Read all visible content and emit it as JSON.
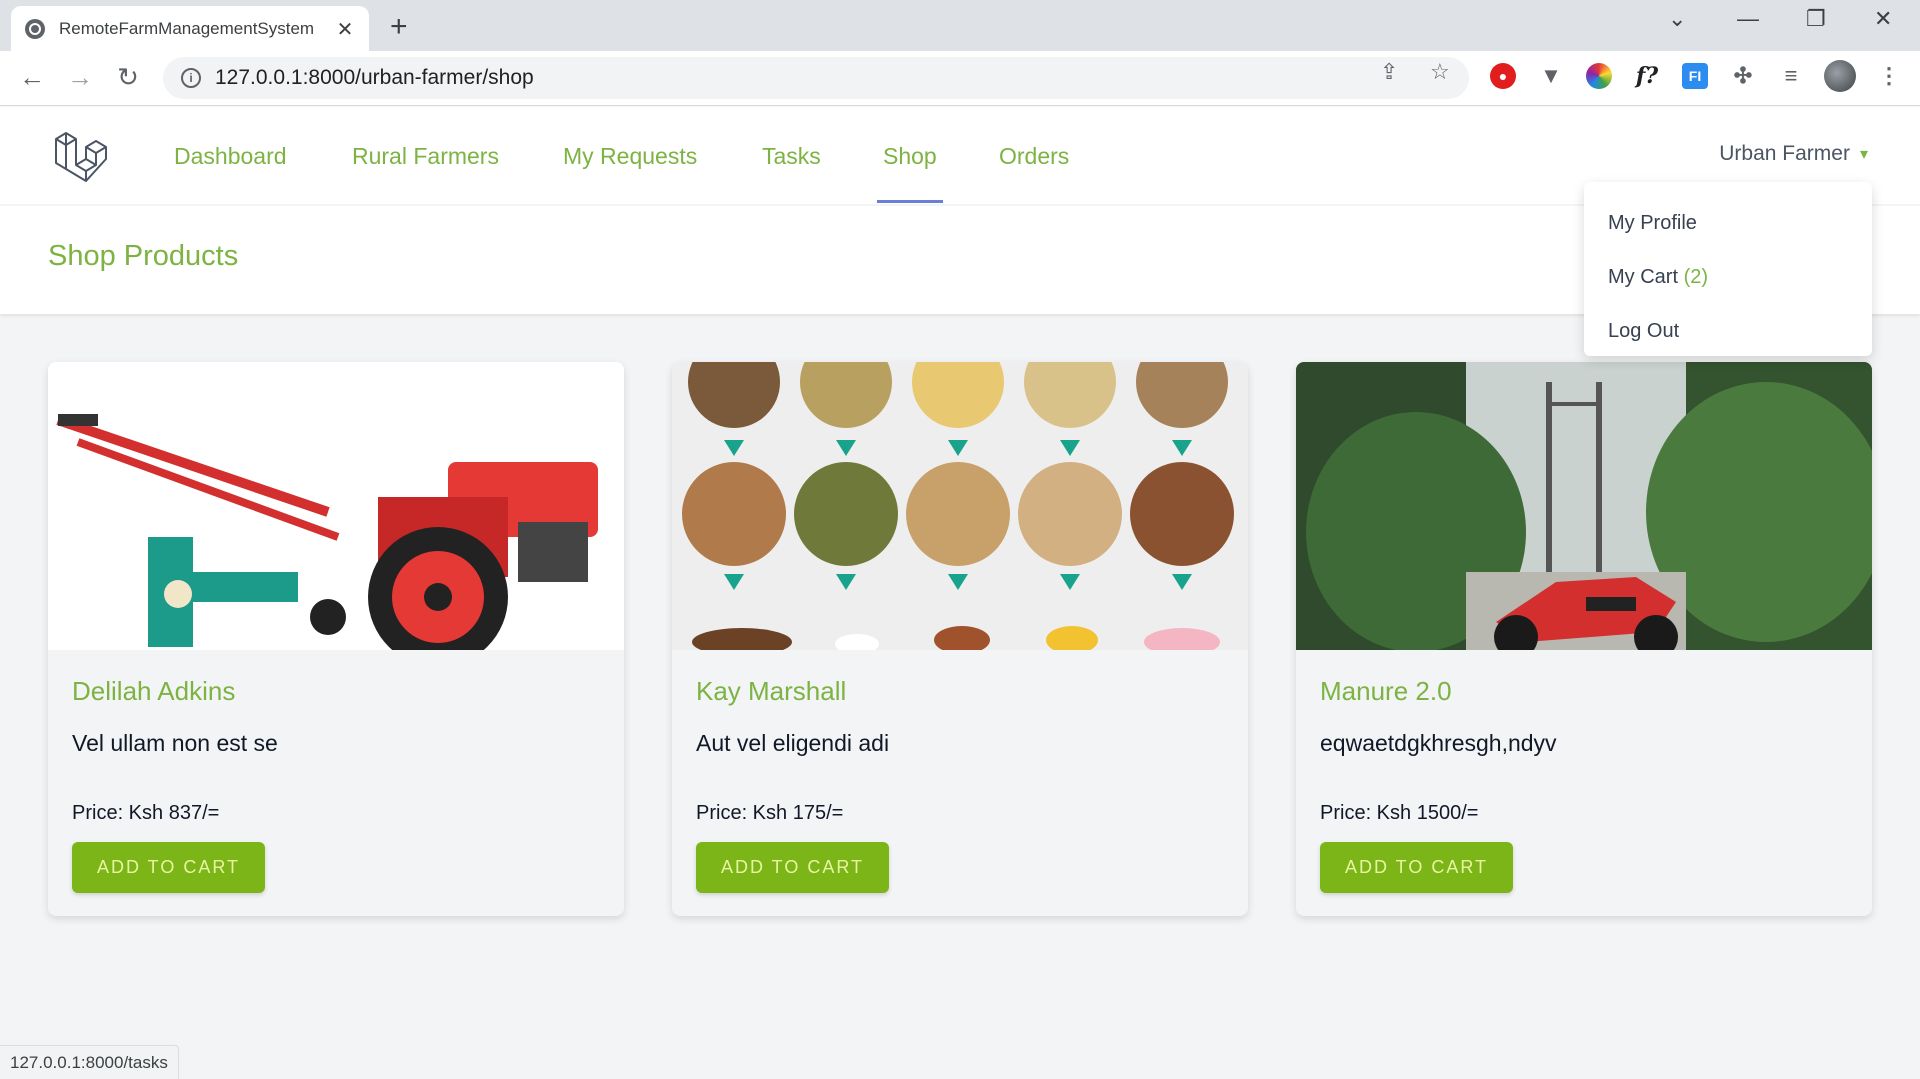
{
  "browser": {
    "tab_title": "RemoteFarmManagementSystem",
    "tab_close": "✕",
    "new_tab": "+",
    "url": "127.0.0.1:8000/urban-farmer/shop",
    "status_url": "127.0.0.1:8000/tasks",
    "extensions": [
      "adblock-icon",
      "vivaldi-icon",
      "color-picker-icon",
      "formula-icon",
      "fi-icon",
      "puzzle-icon",
      "media-icon",
      "avatar"
    ]
  },
  "nav": {
    "links": [
      "Dashboard",
      "Rural Farmers",
      "My Requests",
      "Tasks",
      "Shop",
      "Orders"
    ],
    "active": "Shop",
    "user": "Urban Farmer"
  },
  "dropdown": {
    "profile": "My Profile",
    "cart": "My Cart",
    "cart_count": "(2)",
    "logout": "Log Out"
  },
  "page": {
    "title": "Shop Products"
  },
  "products": [
    {
      "name": "Delilah Adkins",
      "description": "Vel ullam non est se",
      "price": "Price: Ksh 837/=",
      "button": "ADD TO CART",
      "image": "walking-tractor"
    },
    {
      "name": "Kay Marshall",
      "description": "Aut vel eligendi adi",
      "price": "Price: Ksh 175/=",
      "button": "ADD TO CART",
      "image": "animal-feed-pellets"
    },
    {
      "name": "Manure 2.0",
      "description": "eqwaetdgkhresgh,ndyv",
      "price": "Price: Ksh 1500/=",
      "button": "ADD TO CART",
      "image": "red-motorcycle"
    }
  ],
  "colors": {
    "accent": "#7cb342",
    "button": "#7cb518",
    "active_underline": "#6b7fd6"
  }
}
